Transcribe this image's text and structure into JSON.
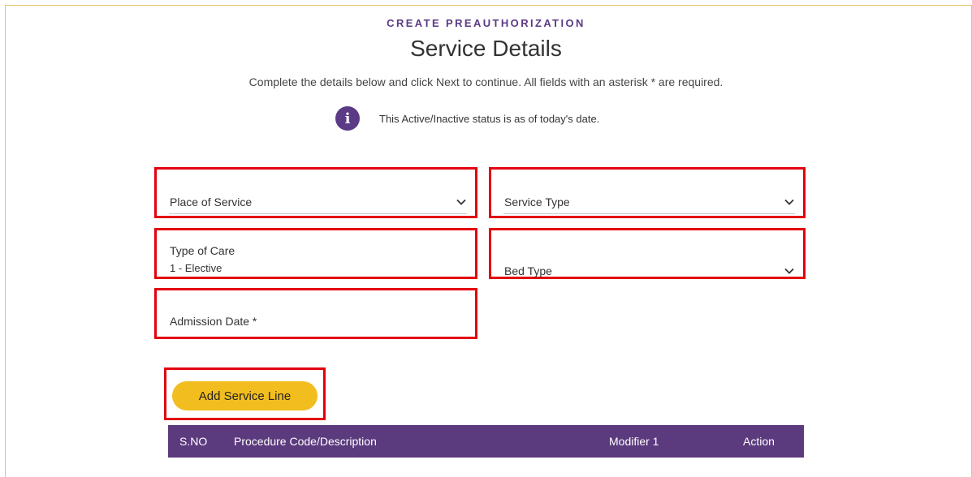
{
  "header": {
    "eyebrow": "CREATE PREAUTHORIZATION",
    "title": "Service Details",
    "subtitle": "Complete the details below and click Next to continue. All fields with an asterisk * are required."
  },
  "notice": {
    "icon": "info-icon",
    "glyph": "i",
    "text": "This Active/Inactive status is as of today's date."
  },
  "form": {
    "place_of_service": {
      "label": "Place of Service"
    },
    "service_type": {
      "label": "Service Type"
    },
    "type_of_care": {
      "label": "Type of Care",
      "value": "1 - Elective"
    },
    "bed_type": {
      "label": "Bed Type"
    },
    "admission_date": {
      "label": "Admission Date *"
    }
  },
  "actions": {
    "add_service_line": "Add Service Line"
  },
  "table": {
    "columns": [
      "S.NO",
      "Procedure Code/Description",
      "Modifier 1",
      "Action"
    ]
  },
  "colors": {
    "brand_purple": "#5b3a86",
    "accent_yellow": "#f2bd1e",
    "highlight_red": "#e3000f"
  }
}
